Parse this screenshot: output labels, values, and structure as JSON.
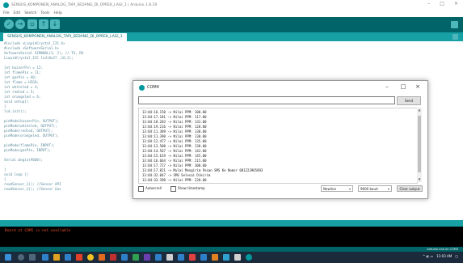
{
  "ide": {
    "title": "SENSUS_KOMPONEN_ANALOG_TAPI_SEDANG_DI_OPREK_LAGI_1 | Arduino 1.8.19",
    "menu": [
      "File",
      "Edit",
      "Sketch",
      "Tools",
      "Help"
    ],
    "tab_name": "SENSUS_KOMPONEN_ANALOG_TAPI_SEDANG_DI_OPREK_LAGI_1",
    "code_lines": [
      "#include <LiquidCrystal_I2C.h>",
      "#include <SoftwareSerial.h>",
      "SoftwareSerial SIM800L(3, 2); // TX, RX",
      "LiquidCrystal_I2C lcd(0x27 ,16,2);",
      "",
      "int buzzerPin = 12;",
      "int flamePin = 11;",
      "int gasPin = A0;",
      "int flame = HIGH;",
      "int whiteled = 4;",
      "int redled = 5;",
      "int orangeled = 6;",
      "void setup()",
      "{",
      "  lcd.init();",
      "",
      "  pinMode(buzzerPin, OUTPUT);",
      "  pinMode(whiteled, OUTPUT);",
      "  pinMode(redled, OUTPUT);",
      "  pinMode(orangeled, OUTPUT);",
      "",
      "  pinMode(flamePin, INPUT);",
      "  pinMode(gasPin, INPUT);",
      "",
      "  Serial.begin(9600);",
      "",
      "}",
      "void loop ()",
      "{",
      "  readSensor_1(); //Sensor API",
      "  readSensor_2(); //Sensor Gas"
    ],
    "console_message": "Board at COM5 is not available",
    "board_info": "Arduino Uno on COM4"
  },
  "serial_monitor": {
    "title": "COM4",
    "send_label": "Send",
    "send_value": "",
    "lines": [
      "13:04:16.150 -> Nilai PPM: 100.00",
      "13:04:17.181 -> Nilai PPM: 117.00",
      "13:04:18.203 -> Nilai PPM: 133.00",
      "13:04:19.216 -> Nilai PPM: 128.00",
      "13:04:11.389 -> Nilai PPM: 130.00",
      "13:04:11.390 -> Nilai PPM: 130.00",
      "13:04:12.477 -> Nilai PPM: 135.00",
      "13:04:13.500 -> Nilai PPM: 138.00",
      "13:04:14.567 -> Nilai PPM: 142.00",
      "13:04:15.619 -> Nilai PPM: 145.00",
      "13:04:16.664 -> Nilai PPM: 215.00",
      "13:04:17.727 -> Nilai PPM: 300.00",
      "13:04:17.821 -> Mulai Mengirim Pesan SMS Ke Nomor 081223965893",
      "13:04:32.047 -> SMS Selesai Dikirim",
      "13:04:33.390 -> Nilai PPM: 220.00",
      "13:04:34.939 -> Nilai PPM: 223.00"
    ],
    "autoscroll_label": "Autoscroll",
    "timestamp_label": "Show timestamp",
    "line_ending": "Newline",
    "baud": "9600 baud",
    "clear_label": "Clear output"
  },
  "taskbar": {
    "time": "11:03 AM"
  },
  "colors": {
    "toolbar": "#006468",
    "tabbar": "#17a1a5",
    "accent": "#4db7bb",
    "console_bg": "#000000",
    "console_text": "#e34c26",
    "taskbar": "#1b2b3c"
  },
  "icons": {
    "verify": "check-icon",
    "upload": "arrow-right-icon",
    "new": "file-new-icon",
    "open": "arrow-up-icon",
    "save": "arrow-down-icon",
    "serial": "magnifier-icon"
  }
}
